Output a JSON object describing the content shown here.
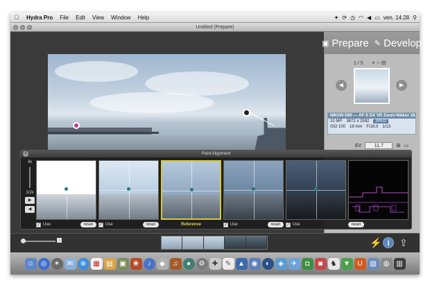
{
  "menubar": {
    "app_name": "Hydra Pro",
    "menus": [
      "File",
      "Edit",
      "View",
      "Window",
      "Help"
    ],
    "clock": "ven. 14:28"
  },
  "window": {
    "title": "Untitled (Prepare)"
  },
  "modes": {
    "prepare": "Prepare",
    "develop": "Develop"
  },
  "sidebar": {
    "counter": "1 / 5",
    "camera": "NIKON D80 — AF-S DX VR Zoom-Nikkor 18...",
    "megapixels": "10 MP",
    "resolution": "3872 x 2592",
    "format": "JPEG",
    "iso": "ISO 100",
    "focal": "18 mm",
    "aperture": "F/16.0",
    "shutter": "1/13",
    "ev_label": "EV",
    "ev_value": "11.7"
  },
  "alignment_panel": {
    "title": "Point Alignment",
    "zoom_max": "4x",
    "zoom_min": "1/2x",
    "tiles": [
      {
        "label": "Use",
        "reset": "reset",
        "reference": false
      },
      {
        "label": "Use",
        "reset": "reset",
        "reference": false
      },
      {
        "label": "Reference",
        "reference": true
      },
      {
        "label": "Use",
        "reset": "reset",
        "reference": false
      },
      {
        "label": "Use",
        "reset": "reset",
        "reference": false
      },
      {
        "label": "",
        "reset": "reset",
        "reference": false
      }
    ]
  },
  "colors": {
    "reference_border": "#d8c93a",
    "accent_pink": "#c13b8f",
    "info_blue": "#5b86c4"
  }
}
